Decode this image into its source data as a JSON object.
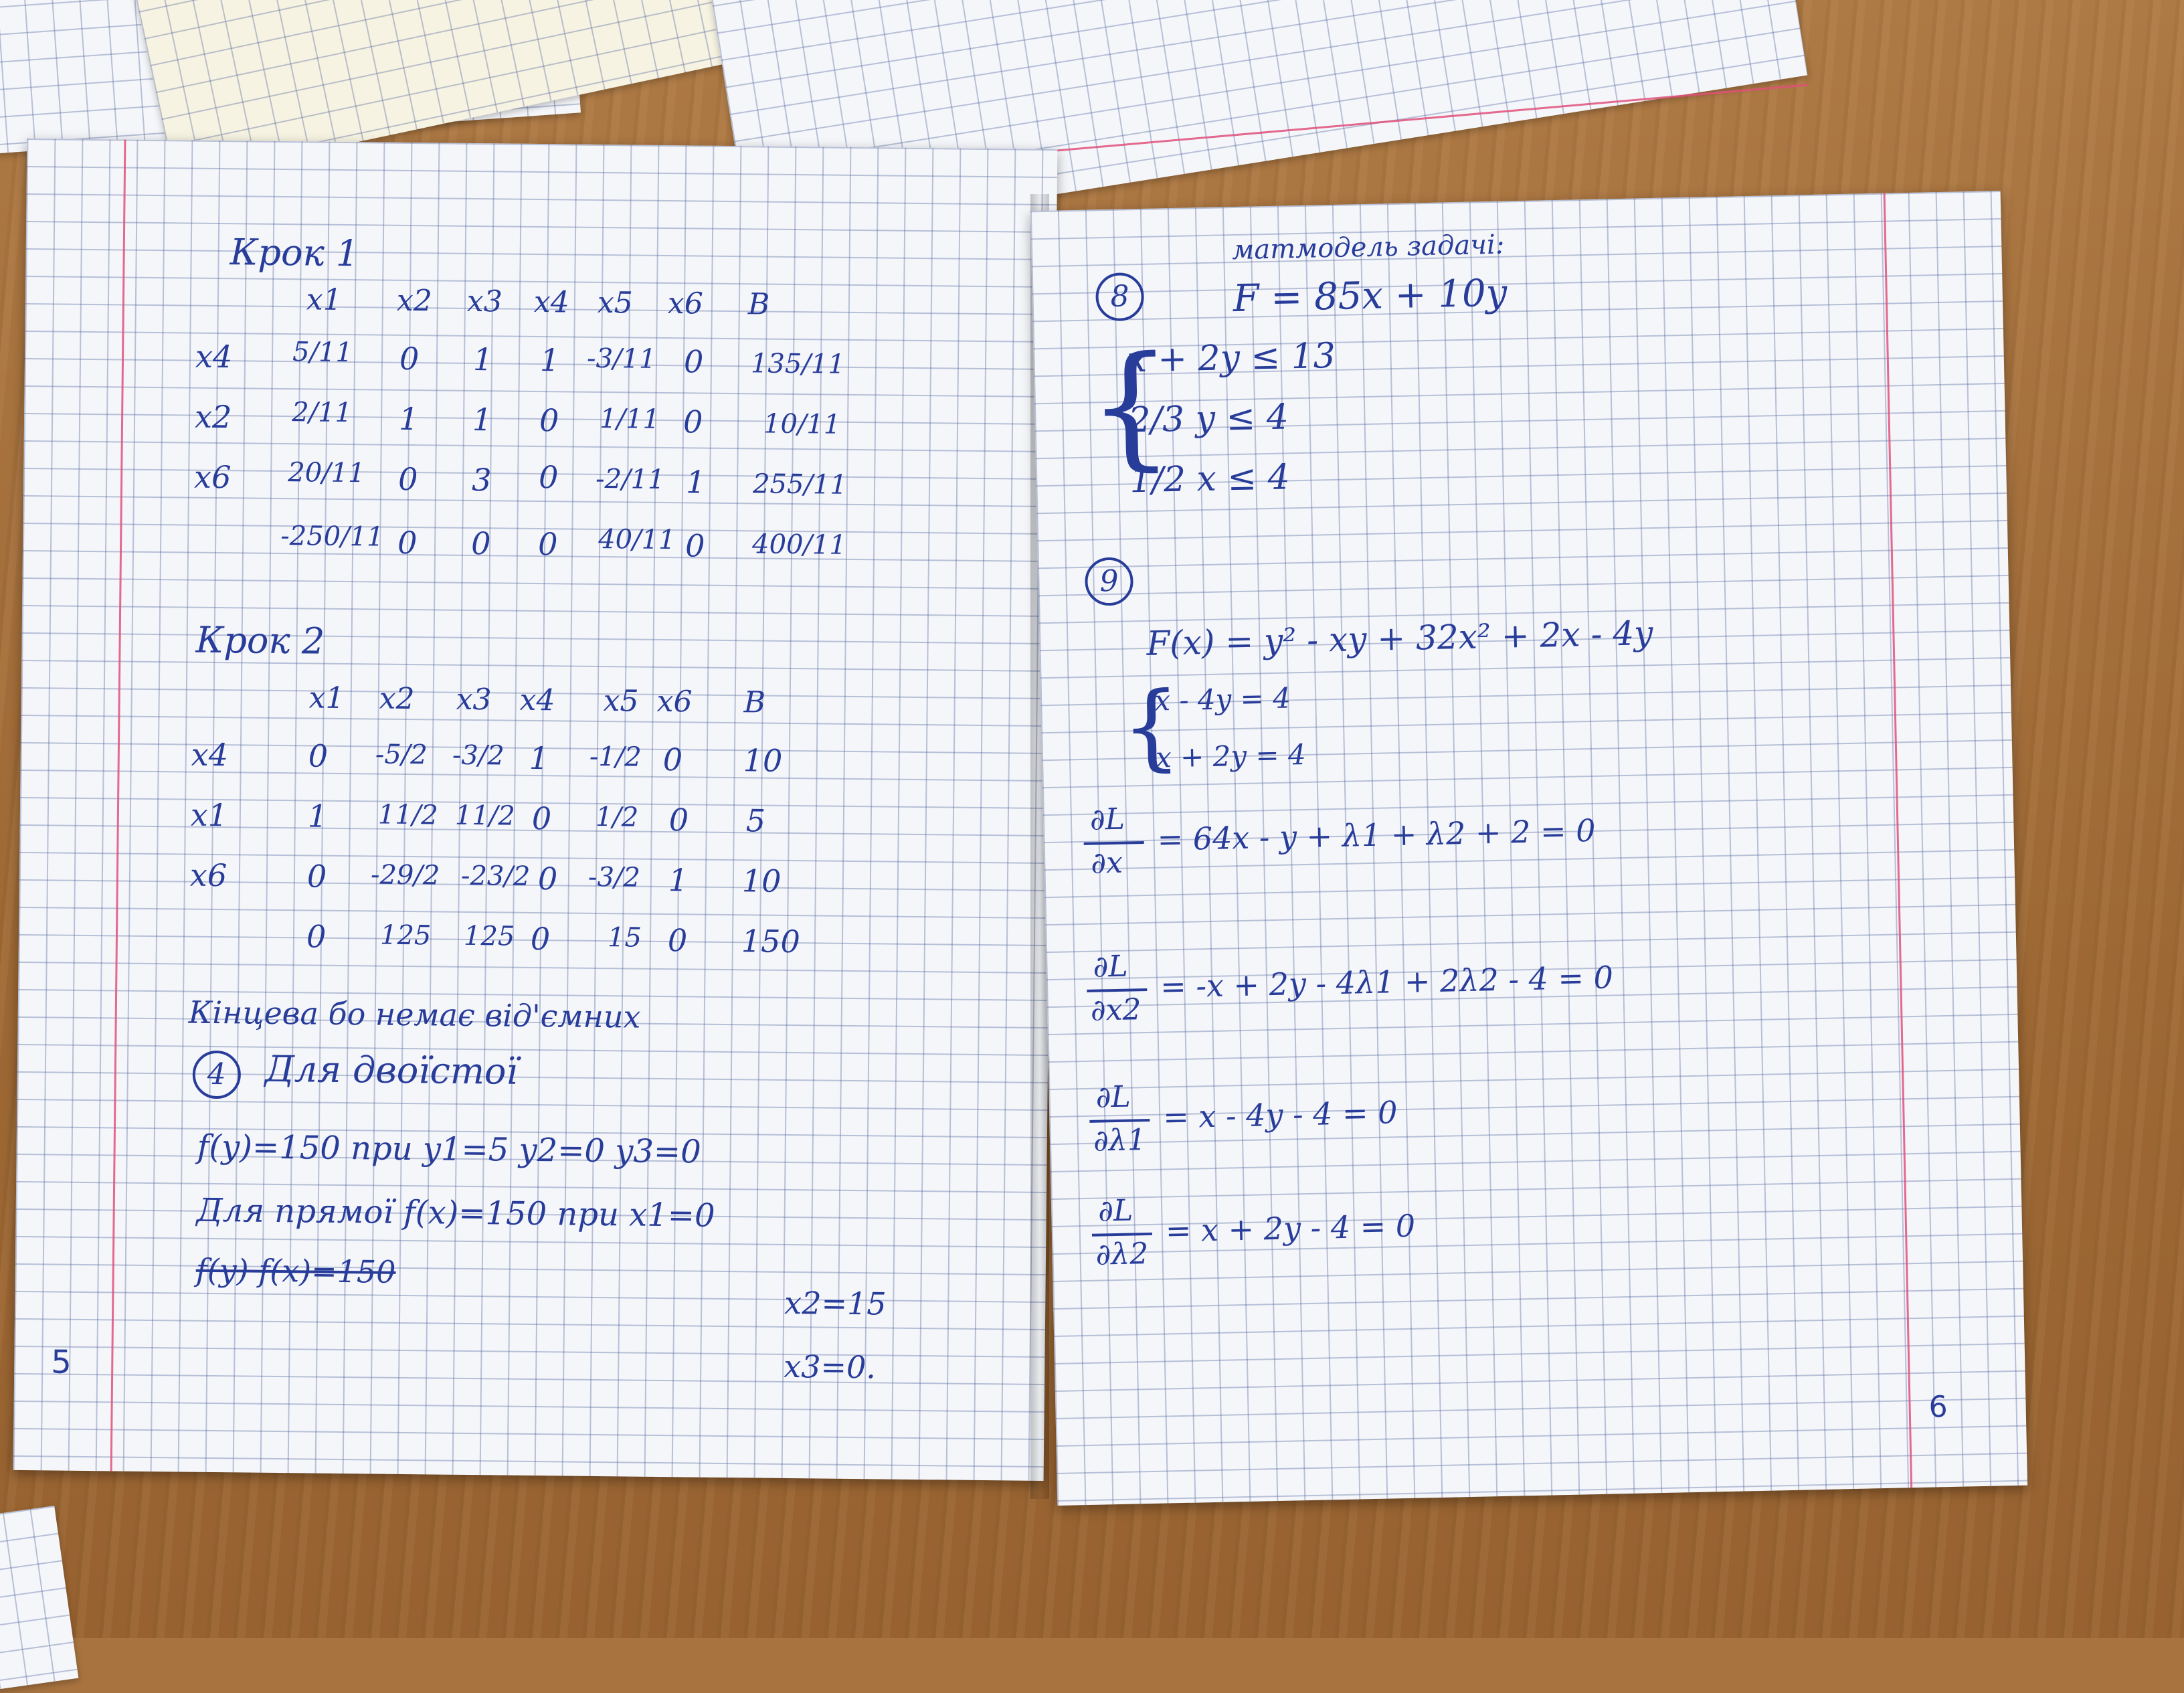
{
  "left_page": {
    "step1": {
      "title": "Крок 1",
      "header": [
        "x1",
        "x2",
        "x3",
        "x4",
        "x5",
        "x6",
        "B"
      ],
      "rows": [
        [
          "x4",
          "5/11",
          "0",
          "1",
          "1",
          "-3/11",
          "0",
          "135/11"
        ],
        [
          "x2",
          "2/11",
          "1",
          "1",
          "0",
          "1/11",
          "0",
          "10/11"
        ],
        [
          "x6",
          "20/11",
          "0",
          "3",
          "0",
          "-2/11",
          "1",
          "255/11"
        ],
        [
          "",
          "-250/11",
          "0",
          "0",
          "0",
          "40/11",
          "0",
          "400/11"
        ]
      ]
    },
    "step2": {
      "title": "Крок 2",
      "header": [
        "x1",
        "x2",
        "x3",
        "x4",
        "x5",
        "x6",
        "B"
      ],
      "rows": [
        [
          "x4",
          "0",
          "-5/2",
          "-3/2",
          "1",
          "-1/2",
          "0",
          "10"
        ],
        [
          "x1",
          "1",
          "11/2",
          "11/2",
          "0",
          "1/2",
          "0",
          "5"
        ],
        [
          "x6",
          "0",
          "-29/2",
          "-23/2",
          "0",
          "-3/2",
          "1",
          "10"
        ],
        [
          "",
          "0",
          "125",
          "125",
          "0",
          "15",
          "0",
          "150"
        ]
      ]
    },
    "final_note": "Кінцева бо немає від'ємних",
    "task4": {
      "number": "4",
      "title": "Для двоїстої",
      "dual_line": "f(y)=150   при   y1=5   y2=0   y3=0",
      "primal_line": "Для прямої   f(x)=150   при  x1=0",
      "struck": "f(y)  f(x)=150",
      "x2": "x2=15",
      "x3": "x3=0."
    },
    "page_number": "5"
  },
  "right_page": {
    "task8": {
      "number": "8",
      "title": "матмодель задачі:",
      "objective": "F = 85x + 10y",
      "constraints": [
        "x + 2y ≤ 13",
        "2/3 y ≤ 4",
        "1/2 x ≤ 4"
      ]
    },
    "task9": {
      "number": "9",
      "function": "F(x) = y² - xy + 32x² + 2x - 4y",
      "system": [
        "x - 4y = 4",
        "x + 2y = 4"
      ],
      "derivatives": [
        {
          "num": "∂L",
          "den": "∂x",
          "expr": "= 64x - y + λ1 + λ2 + 2 = 0"
        },
        {
          "num": "∂L",
          "den": "∂x2",
          "expr": "= -x + 2y - 4λ1 + 2λ2 - 4 = 0"
        },
        {
          "num": "∂L",
          "den": "∂λ1",
          "expr": "= x - 4y - 4 = 0"
        },
        {
          "num": "∂L",
          "den": "∂λ2",
          "expr": "= x + 2y - 4 = 0"
        }
      ]
    },
    "page_number": "6"
  },
  "colors": {
    "ink": "#283c9a",
    "grid": "#465a96",
    "margin": "#e0507a",
    "paper": "#f4f6fa",
    "table": "#a8733f"
  }
}
